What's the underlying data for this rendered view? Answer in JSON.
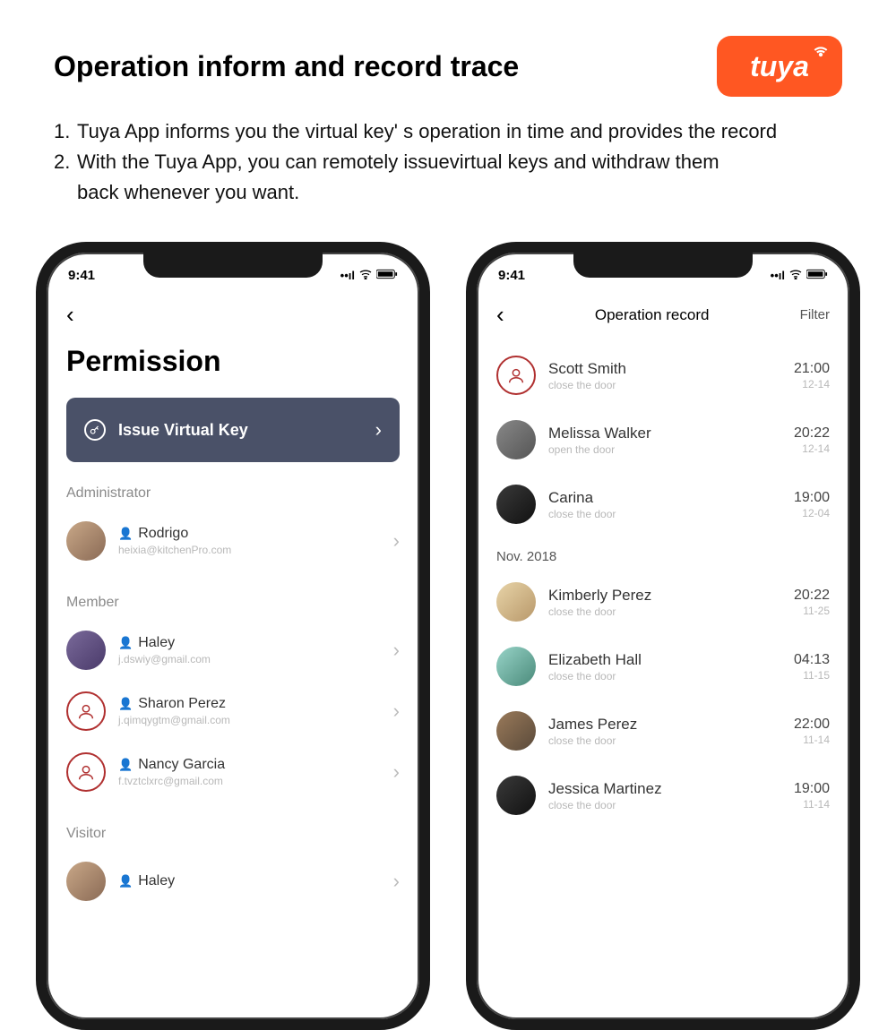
{
  "header": {
    "title": "Operation inform and record trace",
    "logo_text": "tuya"
  },
  "bullets": {
    "b1_num": "1.",
    "b1": "Tuya App informs you the virtual key' s operation in time and provides the record",
    "b2_num": "2.",
    "b2a": "With the Tuya App, you can remotely issuevirtual keys and withdraw them",
    "b2b": "back whenever you want."
  },
  "status": {
    "time": "9:41"
  },
  "phone1": {
    "page_title": "Permission",
    "issue_label": "Issue Virtual Key",
    "sections": {
      "admin": "Administrator",
      "member": "Member",
      "visitor": "Visitor"
    },
    "admin": [
      {
        "name": "Rodrigo",
        "sub": "heixia@kitchenPro.com"
      }
    ],
    "members": [
      {
        "name": "Haley",
        "sub": "j.dswiy@gmail.com"
      },
      {
        "name": "Sharon Perez",
        "sub": "j.qimqygtm@gmail.com"
      },
      {
        "name": "Nancy Garcia",
        "sub": "f.tvztclxrc@gmail.com"
      }
    ],
    "visitors": [
      {
        "name": "Haley"
      }
    ]
  },
  "phone2": {
    "nav_title": "Operation record",
    "filter": "Filter",
    "month_label": "Nov. 2018",
    "records_top": [
      {
        "name": "Scott Smith",
        "action": "close the door",
        "time": "21:00",
        "date": "12-14"
      },
      {
        "name": "Melissa Walker",
        "action": "open the door",
        "time": "20:22",
        "date": "12-14"
      },
      {
        "name": "Carina",
        "action": "close the door",
        "time": "19:00",
        "date": "12-04"
      }
    ],
    "records_nov": [
      {
        "name": "Kimberly Perez",
        "action": "close the door",
        "time": "20:22",
        "date": "11-25"
      },
      {
        "name": "Elizabeth Hall",
        "action": "close the door",
        "time": "04:13",
        "date": "11-15"
      },
      {
        "name": "James Perez",
        "action": "close the door",
        "time": "22:00",
        "date": "11-14"
      },
      {
        "name": "Jessica Martinez",
        "action": "close the door",
        "time": "19:00",
        "date": "11-14"
      }
    ]
  }
}
